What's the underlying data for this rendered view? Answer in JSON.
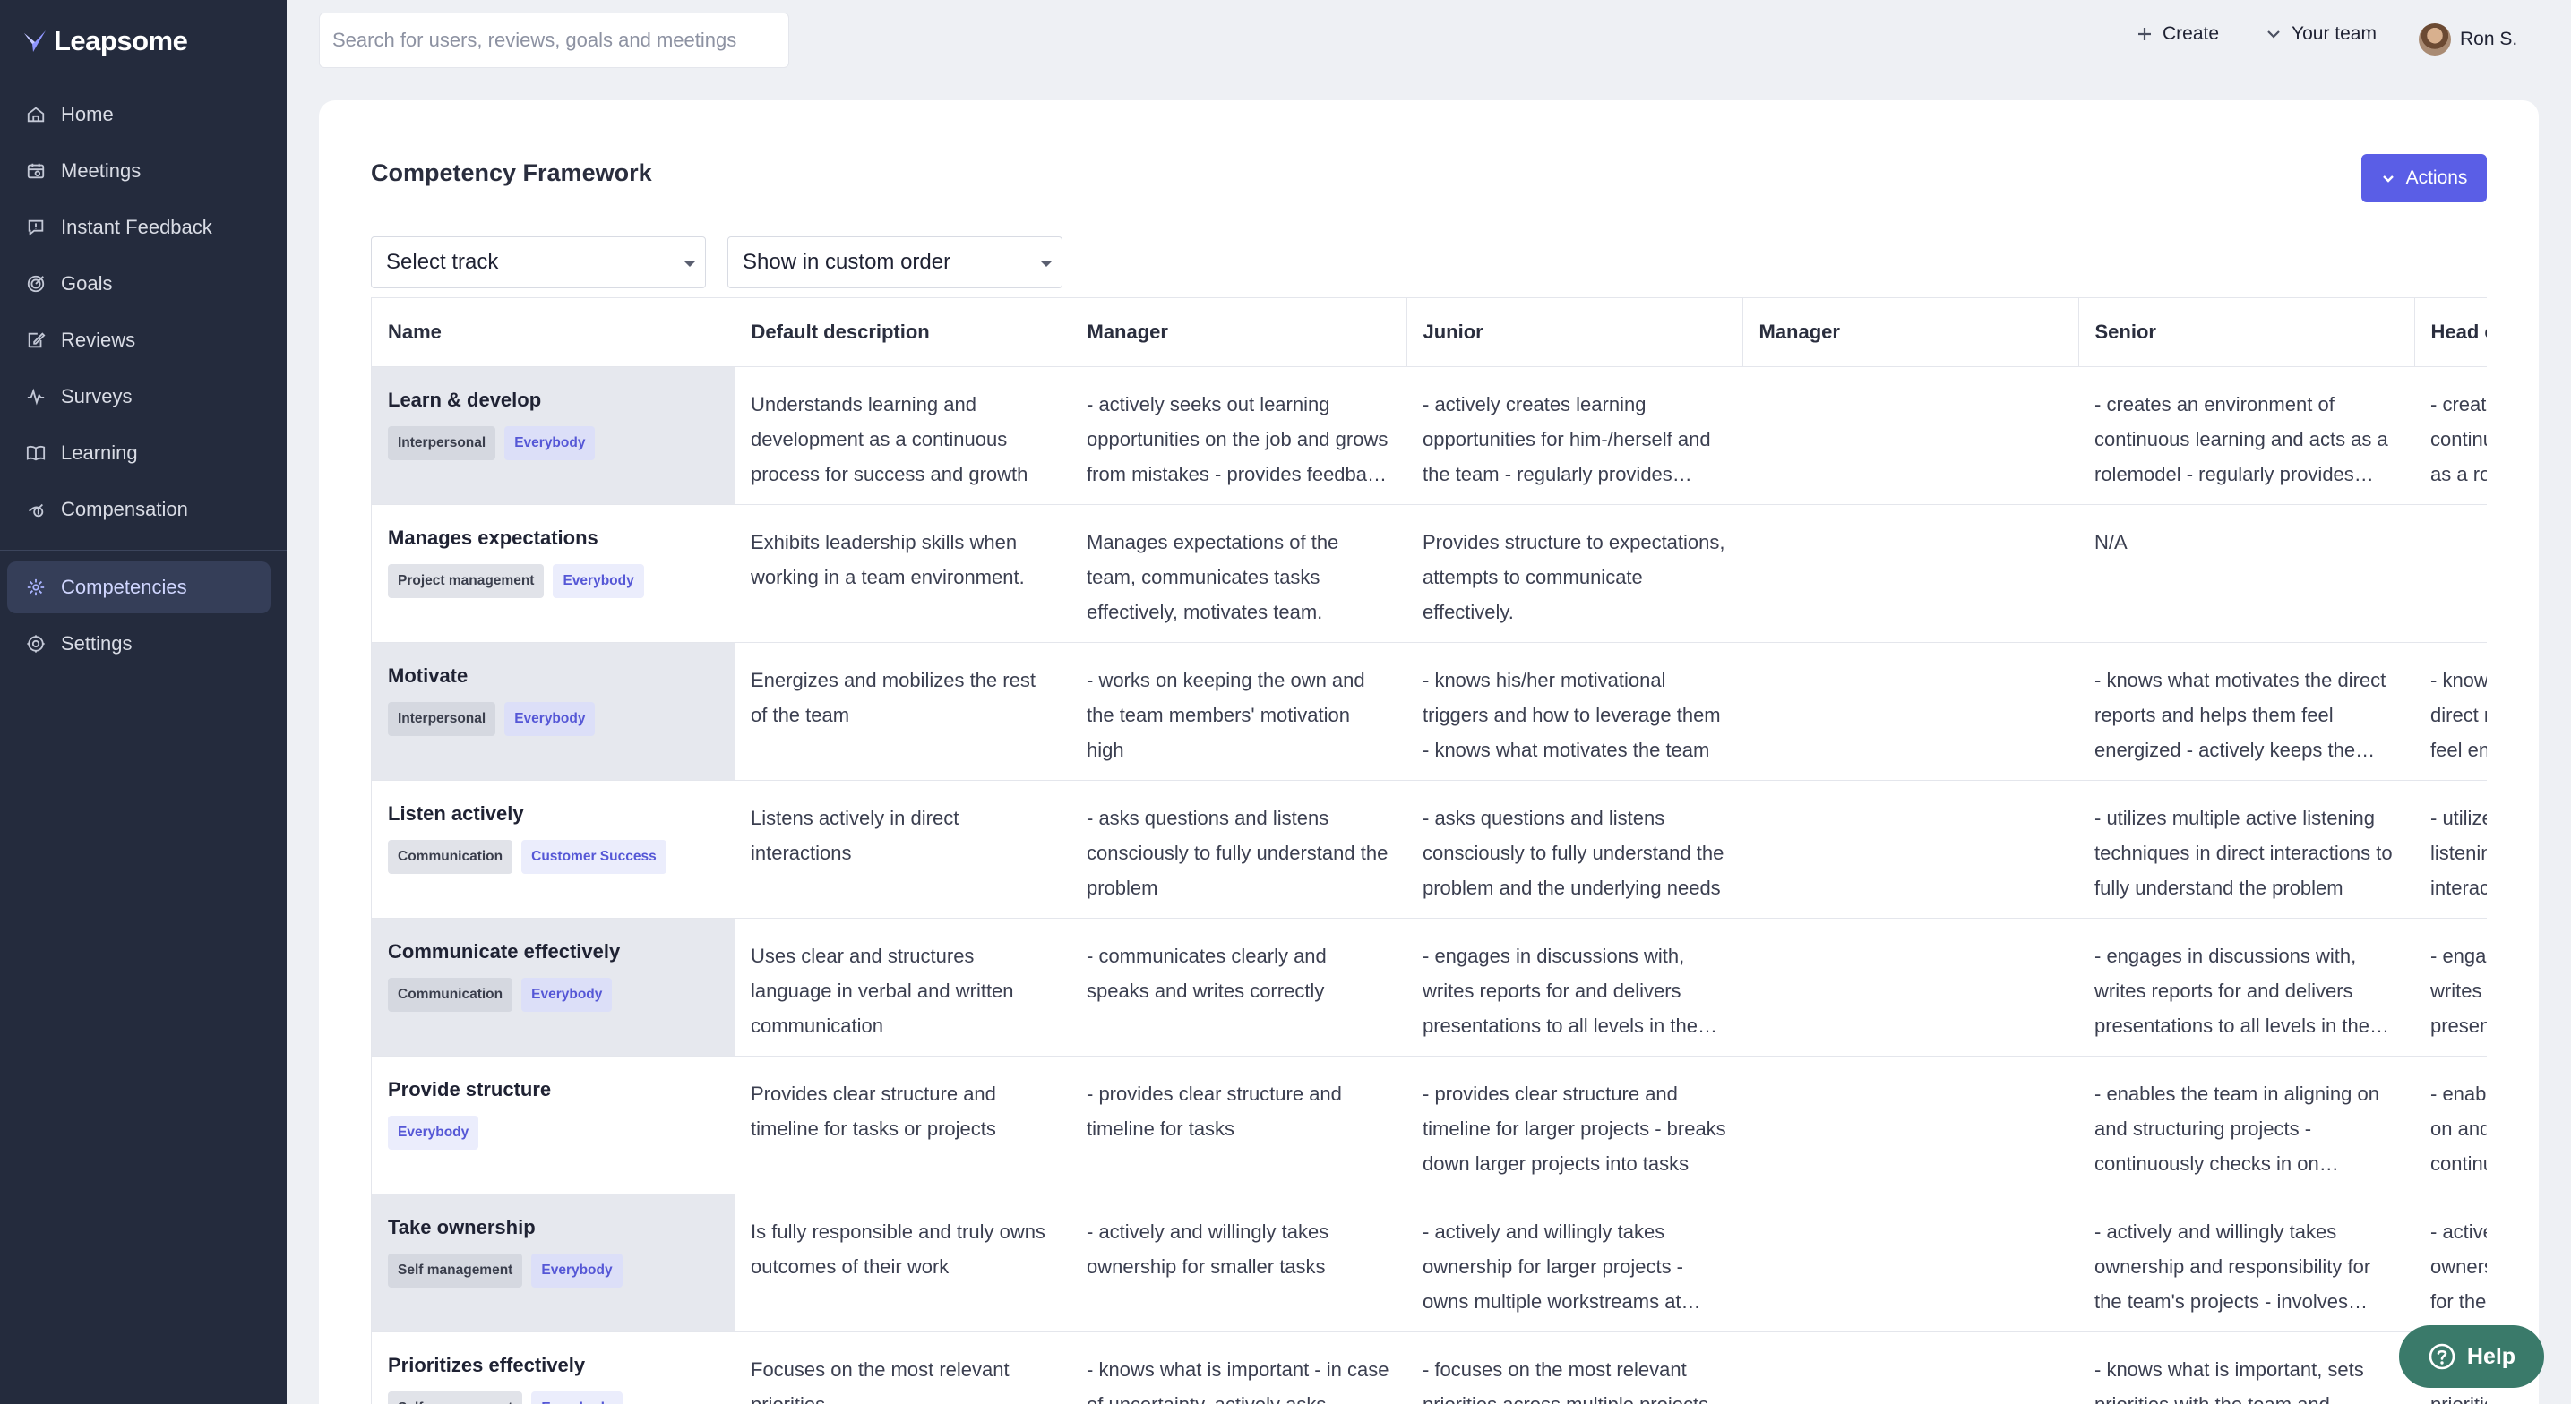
{
  "app": {
    "name": "Leapsome"
  },
  "sidebar": {
    "items": [
      {
        "label": "Home",
        "icon": "home-icon"
      },
      {
        "label": "Meetings",
        "icon": "meetings-icon"
      },
      {
        "label": "Instant Feedback",
        "icon": "feedback-icon"
      },
      {
        "label": "Goals",
        "icon": "goals-icon"
      },
      {
        "label": "Reviews",
        "icon": "reviews-icon"
      },
      {
        "label": "Surveys",
        "icon": "surveys-icon"
      },
      {
        "label": "Learning",
        "icon": "learning-icon"
      },
      {
        "label": "Compensation",
        "icon": "compensation-icon"
      },
      {
        "label": "Competencies",
        "icon": "competencies-icon",
        "active": true
      },
      {
        "label": "Settings",
        "icon": "settings-icon"
      }
    ]
  },
  "topbar": {
    "search_placeholder": "Search for users, reviews, goals and meetings",
    "create_label": "Create",
    "team_label": "Your team",
    "user_name": "Ron S."
  },
  "page": {
    "title": "Competency Framework",
    "actions_label": "Actions",
    "track_select": "Select track",
    "order_select": "Show in custom order"
  },
  "table": {
    "columns": [
      "Name",
      "Default description",
      "Manager",
      "Junior",
      "Manager",
      "Senior",
      "Head of"
    ],
    "rows": [
      {
        "name": "Learn & develop",
        "category": "Interpersonal",
        "group": "Everybody",
        "cells": [
          "Understands learning and development as a continuous process for success and growth",
          "- actively seeks out learning opportunities on the job and grows from mistakes - provides feedback to peers",
          "- actively creates learning opportunities for him-/herself and the team - regularly provides feedback",
          "",
          "- creates an environment of continuous learning and acts as a rolemodel - regularly provides feedback",
          "- creates an environment of continuous learning and acts as a rolemodel"
        ]
      },
      {
        "name": "Manages expectations",
        "category": "Project management",
        "group": "Everybody",
        "cells": [
          "Exhibits leadership skills when working in a team environment.",
          "Manages expectations of the team, communicates tasks effectively, motivates team.",
          "Provides structure to expectations, attempts to communicate effectively.",
          "",
          "N/A",
          ""
        ]
      },
      {
        "name": "Motivate",
        "category": "Interpersonal",
        "group": "Everybody",
        "cells": [
          "Energizes and mobilizes the rest of the team",
          "- works on keeping the own and the team members' motivation high",
          "- knows his/her motivational triggers and how to leverage them - knows what motivates the team",
          "",
          "- knows what motivates the direct reports and helps them feel energized - actively keeps the team engaged",
          "- knows what motivates the direct reports and helps them feel energized"
        ]
      },
      {
        "name": "Listen actively",
        "category": "Communication",
        "group": "Customer Success",
        "cells": [
          "Listens actively in direct interactions",
          "- asks questions and listens consciously to fully understand the problem",
          "- asks questions and listens consciously to fully understand the problem and the underlying needs",
          "",
          "- utilizes multiple active listening techniques in direct interactions to fully understand the problem",
          "- utilizes multiple active listening techniques in direct interactions to fully understand"
        ]
      },
      {
        "name": "Communicate effectively",
        "category": "Communication",
        "group": "Everybody",
        "cells": [
          "Uses clear and structures language in verbal and written communication",
          "- communicates clearly and speaks and writes correctly",
          "- engages in discussions with, writes reports for and delivers presentations to all levels in the organization",
          "",
          "- engages in discussions with, writes reports for and delivers presentations to all levels in the organization",
          "- engages in discussions with, writes reports for and delivers presentations"
        ]
      },
      {
        "name": "Provide structure",
        "category": "",
        "group": "Everybody",
        "cells": [
          "Provides clear structure and timeline for tasks or projects",
          "- provides clear structure and timeline for tasks",
          "- provides clear structure and timeline for larger projects - breaks down larger projects into tasks",
          "",
          "- enables the team in aligning on and structuring projects - continuously checks in on progress",
          "- enables the team in aligning on and structuring projects - continuously checks in"
        ]
      },
      {
        "name": "Take ownership",
        "category": "Self management",
        "group": "Everybody",
        "cells": [
          "Is fully responsible and truly owns outcomes of their work",
          "- actively and willingly takes ownership for smaller tasks",
          "- actively and willingly takes ownership for larger projects - owns multiple workstreams at once",
          "",
          "- actively and willingly takes ownership and responsibility for the team's projects - involves others",
          "- actively and willingly takes ownership and responsibility for the team"
        ]
      },
      {
        "name": "Prioritizes effectively",
        "category": "Self management",
        "group": "Everybody",
        "cells": [
          "Focuses on the most relevant priorities",
          "- knows what is important - in case of uncertainty, actively asks",
          "- focuses on the most relevant priorities across multiple projects",
          "",
          "- knows what is important, sets priorities with the team and stakeholders",
          "- knows what is important, sets priorities"
        ]
      }
    ]
  },
  "help": {
    "label": "Help"
  },
  "colors": {
    "sidebar_bg": "#242b3d",
    "accent": "#5a5ee6",
    "help_bg": "#3a7a6a"
  }
}
